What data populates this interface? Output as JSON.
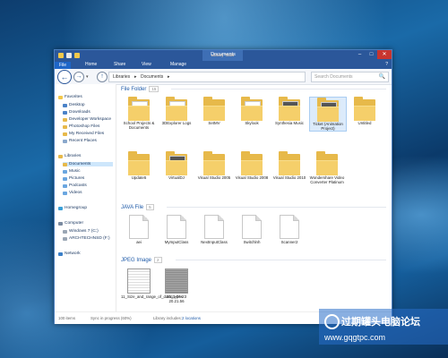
{
  "window": {
    "title": "Documents",
    "context_tab": "Library Tools",
    "minimize": "–",
    "maximize": "□",
    "close": "✕"
  },
  "ribbon": {
    "tabs": [
      "File",
      "Home",
      "Share",
      "View",
      "Manage"
    ],
    "help": "?"
  },
  "address": {
    "back": "←",
    "forward": "→",
    "recent": "▾",
    "up": "↑",
    "crumbs": [
      "Libraries",
      "▸",
      "Documents",
      "▸"
    ],
    "search_placeholder": "Search Documents",
    "search_icon": "🔍"
  },
  "nav": {
    "favorites_header": "Favorites",
    "favorites": [
      "Desktop",
      "Downloads",
      "Developer Workspace",
      "Photoshop Files",
      "My Received Files",
      "Recent Places"
    ],
    "libraries_header": "Libraries",
    "libraries": [
      "Documents",
      "Music",
      "Pictures",
      "Podcasts",
      "Videos"
    ],
    "homegroup": "Homegroup",
    "computer_header": "Computer",
    "drives": [
      "Windows 7 (C:)",
      "ARCHTECHNSD (F:)"
    ],
    "network": "Network"
  },
  "groups": {
    "folders": {
      "label": "File Folder",
      "count": "15"
    },
    "java": {
      "label": "JAVA File",
      "count": "5"
    },
    "jpeg": {
      "label": "JPEG Image",
      "count": "2"
    }
  },
  "folders_row1": [
    "School Projects & Documents",
    "3DExplorer Logs",
    "SetMV",
    "Skylook",
    "Synthesia Music",
    "Ticket (Animation Project)",
    "Untitled"
  ],
  "folders_row2": [
    "Update5",
    "VirtualDJ",
    "Visual Studio 2005",
    "Visual Studio 2008",
    "Visual Studio 2010",
    "Wondershare Video Converter Platinum"
  ],
  "java_files": [
    "aei",
    "MyInputClass",
    "NextInputClass",
    "Switchlnh",
    "Scanner2"
  ],
  "images": [
    "11_Size_and_range_of_data_types",
    "2011-06-23 20.21.56"
  ],
  "status": {
    "items": "100 items",
    "sync": "Sync in progress (60%)",
    "library": "Library includes:",
    "locations": "2 locations"
  },
  "watermark": {
    "text": "过期罐头电脑论坛",
    "url": "www.gqgtpc.com"
  },
  "colors": {
    "ribbon": "#2b579a",
    "folder": "#e7b94a",
    "close": "#c7352f"
  }
}
